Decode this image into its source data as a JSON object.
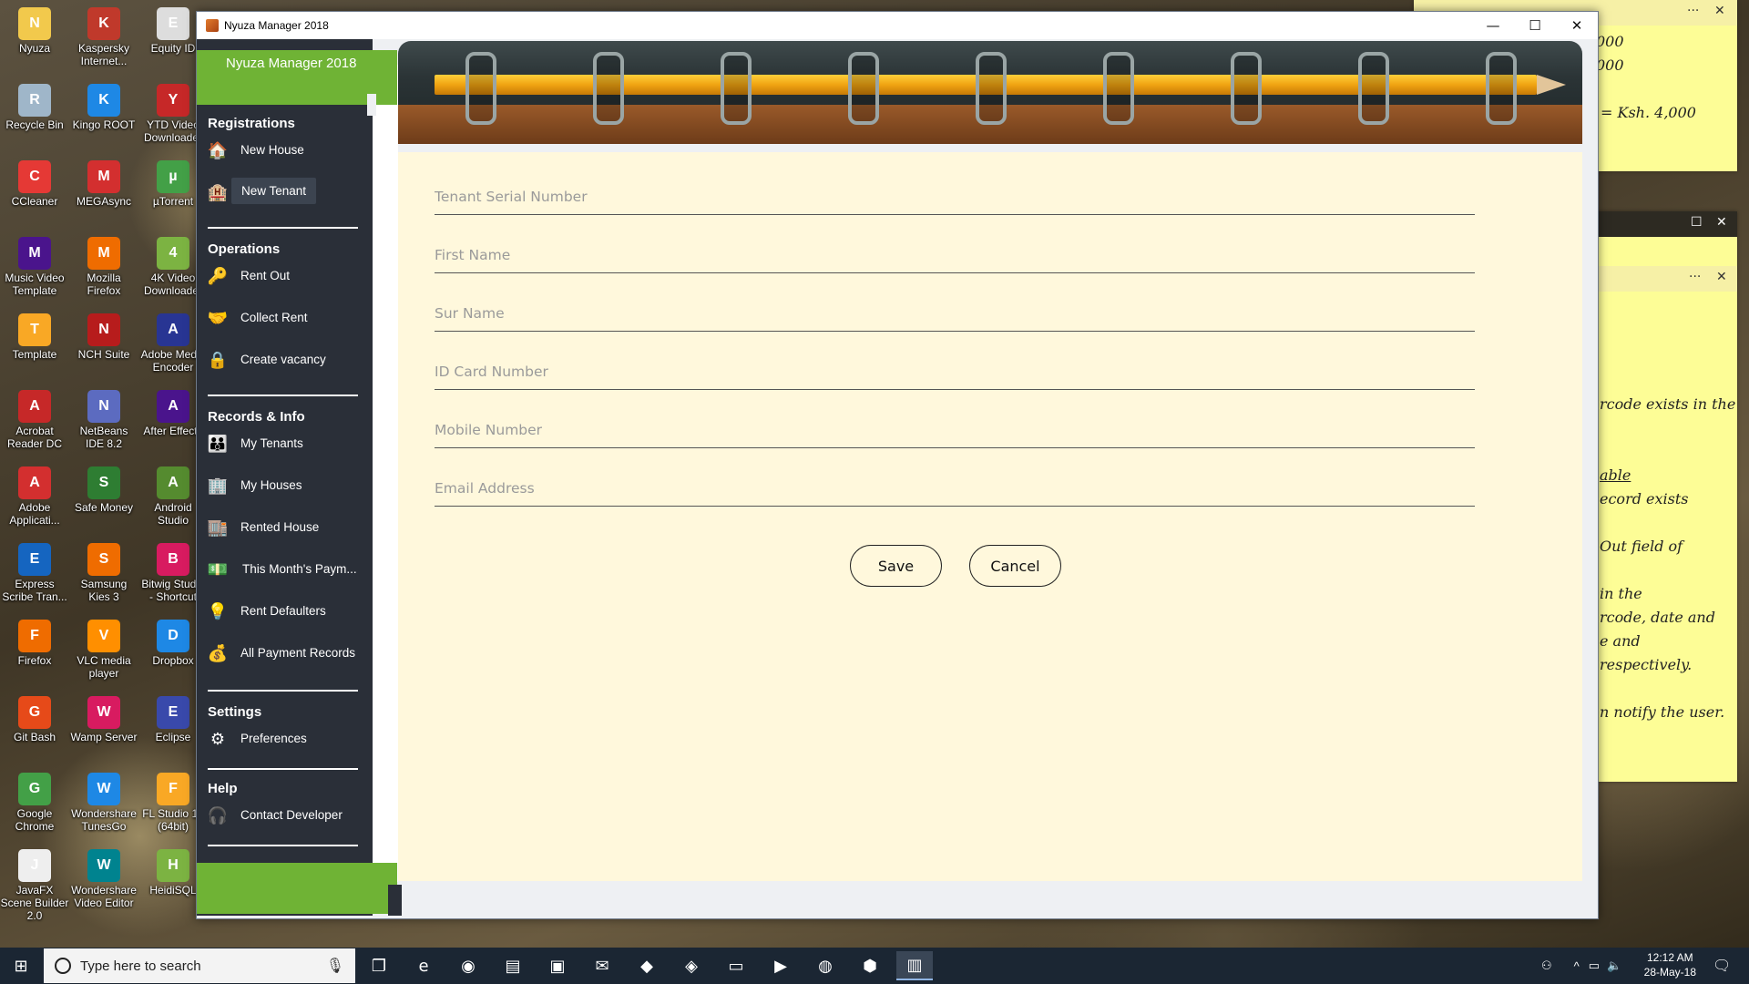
{
  "desktop": {
    "icons": [
      {
        "label": "Nyuza",
        "icon": "folder-icon",
        "color": "#f2c94c"
      },
      {
        "label": "Kaspersky Internet...",
        "icon": "kaspersky-icon",
        "color": "#c0392b"
      },
      {
        "label": "Equity ID",
        "icon": "document-icon",
        "color": "#dddddd"
      },
      {
        "label": "Recycle Bin",
        "icon": "recycle-bin-icon",
        "color": "#9fb6c9"
      },
      {
        "label": "Kingo ROOT",
        "icon": "kingo-icon",
        "color": "#1e88e5"
      },
      {
        "label": "YTD Video Downloader",
        "icon": "ytd-icon",
        "color": "#c62828"
      },
      {
        "label": "CCleaner",
        "icon": "ccleaner-icon",
        "color": "#e53935"
      },
      {
        "label": "MEGAsync",
        "icon": "mega-icon",
        "color": "#d32f2f"
      },
      {
        "label": "µTorrent",
        "icon": "utorrent-icon",
        "color": "#43a047"
      },
      {
        "label": "Music Video Template",
        "icon": "after-effects-icon",
        "color": "#4a148c"
      },
      {
        "label": "Mozilla Firefox",
        "icon": "firefox-icon",
        "color": "#ef6c00"
      },
      {
        "label": "4K Video Downloader",
        "icon": "4k-icon",
        "color": "#7cb342"
      },
      {
        "label": "Template",
        "icon": "fl-studio-icon",
        "color": "#f9a825"
      },
      {
        "label": "NCH Suite",
        "icon": "nch-icon",
        "color": "#b71c1c"
      },
      {
        "label": "Adobe Media Encoder",
        "icon": "media-encoder-icon",
        "color": "#283593"
      },
      {
        "label": "Acrobat Reader DC",
        "icon": "acrobat-icon",
        "color": "#c62828"
      },
      {
        "label": "NetBeans IDE 8.2",
        "icon": "netbeans-icon",
        "color": "#5c6bc0"
      },
      {
        "label": "After Effects",
        "icon": "after-effects-icon",
        "color": "#4a148c"
      },
      {
        "label": "Adobe Applicati...",
        "icon": "adobe-icon",
        "color": "#d32f2f"
      },
      {
        "label": "Safe Money",
        "icon": "safe-money-icon",
        "color": "#2e7d32"
      },
      {
        "label": "Android Studio",
        "icon": "android-studio-icon",
        "color": "#558b2f"
      },
      {
        "label": "Express Scribe Tran...",
        "icon": "express-scribe-icon",
        "color": "#1565c0"
      },
      {
        "label": "Samsung Kies 3",
        "icon": "kies-icon",
        "color": "#ef6c00"
      },
      {
        "label": "Bitwig Studio - Shortcut",
        "icon": "bitwig-icon",
        "color": "#d81b60"
      },
      {
        "label": "Firefox",
        "icon": "firefox-icon",
        "color": "#ef6c00"
      },
      {
        "label": "VLC media player",
        "icon": "vlc-icon",
        "color": "#ff8f00"
      },
      {
        "label": "Dropbox",
        "icon": "dropbox-icon",
        "color": "#1e88e5"
      },
      {
        "label": "Git Bash",
        "icon": "git-icon",
        "color": "#e64a19"
      },
      {
        "label": "Wamp Server",
        "icon": "wamp-icon",
        "color": "#d81b60"
      },
      {
        "label": "Eclipse",
        "icon": "eclipse-icon",
        "color": "#3949ab"
      },
      {
        "label": "Google Chrome",
        "icon": "chrome-icon",
        "color": "#43a047"
      },
      {
        "label": "Wondershare TunesGo",
        "icon": "tunesgo-icon",
        "color": "#1e88e5"
      },
      {
        "label": "FL Studio 12 (64bit)",
        "icon": "fl-studio-icon",
        "color": "#f9a825"
      },
      {
        "label": "JavaFX Scene Builder 2.0",
        "icon": "scene-builder-icon",
        "color": "#eeeeee"
      },
      {
        "label": "Wondershare Video Editor",
        "icon": "video-editor-icon",
        "color": "#00838f"
      },
      {
        "label": "HeidiSQL",
        "icon": "heidisql-icon",
        "color": "#7cb342"
      }
    ]
  },
  "sticky_notes": {
    "top_lines": [
      "000",
      "000",
      "= Ksh. 4,000"
    ],
    "bottom_lines": [
      "rcode exists in the",
      "able",
      "ecord exists",
      "Out field of",
      "in the",
      "rcode, date and",
      "e and",
      "respectively.",
      "n notify the user."
    ]
  },
  "window": {
    "title": "Nyuza Manager 2018",
    "controls": {
      "minimize": "—",
      "maximize": "☐",
      "close": "✕"
    }
  },
  "sidebar": {
    "brand": "Nyuza Manager 2018",
    "sections": [
      {
        "title": "Registrations",
        "items": [
          {
            "label": "New House",
            "icon": "house-icon"
          },
          {
            "label": "New Tenant",
            "icon": "tenant-icon",
            "active": true
          }
        ]
      },
      {
        "title": "Operations",
        "items": [
          {
            "label": "Rent Out",
            "icon": "key-icon"
          },
          {
            "label": "Collect Rent",
            "icon": "handshake-icon"
          },
          {
            "label": "Create vacancy",
            "icon": "padlock-icon"
          }
        ]
      },
      {
        "title": "Records & Info",
        "items": [
          {
            "label": "My Tenants",
            "icon": "people-icon"
          },
          {
            "label": "My Houses",
            "icon": "building-icon"
          },
          {
            "label": "Rented House",
            "icon": "tower-icon"
          },
          {
            "label": "This Month's Paym...",
            "icon": "cash-icon"
          },
          {
            "label": "Rent Defaulters",
            "icon": "lightbulb-icon"
          },
          {
            "label": "All Payment Records",
            "icon": "money-bag-icon"
          }
        ]
      },
      {
        "title": "Settings",
        "items": [
          {
            "label": "Preferences",
            "icon": "gears-icon"
          }
        ]
      },
      {
        "title": "Help",
        "items": [
          {
            "label": "Contact Developer",
            "icon": "support-icon"
          }
        ]
      }
    ]
  },
  "form": {
    "fields": [
      {
        "name": "tenant-serial-number",
        "placeholder": "Tenant Serial Number",
        "value": ""
      },
      {
        "name": "first-name",
        "placeholder": "First Name",
        "value": ""
      },
      {
        "name": "sur-name",
        "placeholder": "Sur Name",
        "value": ""
      },
      {
        "name": "id-card-number",
        "placeholder": "ID Card Number",
        "value": ""
      },
      {
        "name": "mobile-number",
        "placeholder": "Mobile Number",
        "value": ""
      },
      {
        "name": "email-address",
        "placeholder": "Email Address",
        "value": ""
      }
    ],
    "save_label": "Save",
    "cancel_label": "Cancel"
  },
  "taskbar": {
    "search_placeholder": "Type here to search",
    "clock_time": "12:12 AM",
    "clock_date": "28-May-18",
    "apps": [
      "task-view-icon",
      "edge-icon",
      "firefox-icon",
      "file-explorer-icon",
      "store-icon",
      "mail-icon",
      "app-icon",
      "netbeans-icon",
      "monitor-icon",
      "media-icon",
      "chrome-icon",
      "box-icon",
      "nyuza-icon"
    ]
  },
  "colors": {
    "sidebar_bg": "#2a2f38",
    "accent_green": "#6fb335",
    "form_bg": "#fff8dc",
    "sticky_yellow": "#fdfd96"
  }
}
